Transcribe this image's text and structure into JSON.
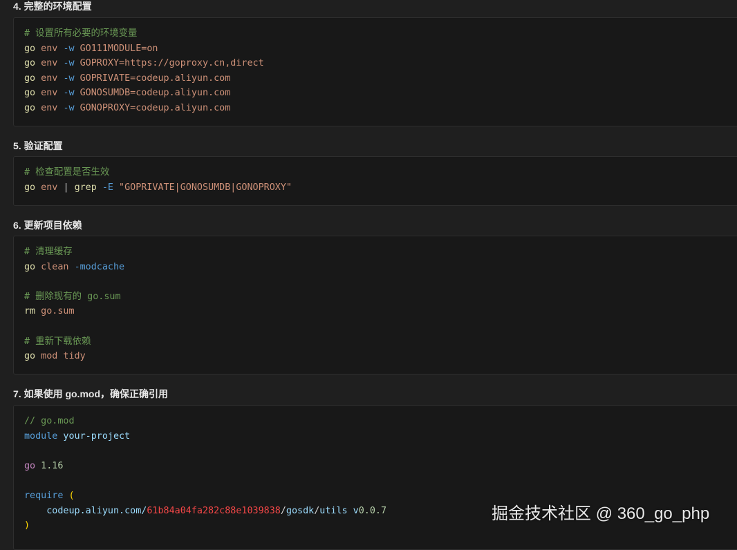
{
  "sections": [
    {
      "heading": "4. 完整的环境配置",
      "lines": [
        [
          {
            "t": "# 设置所有必要的环境变量",
            "k": "comment"
          }
        ],
        [
          {
            "t": "go",
            "k": "cmd"
          },
          {
            "t": " env ",
            "k": "arg"
          },
          {
            "t": "-w",
            "k": "flag"
          },
          {
            "t": " GO111MODULE=on",
            "k": "arg"
          }
        ],
        [
          {
            "t": "go",
            "k": "cmd"
          },
          {
            "t": " env ",
            "k": "arg"
          },
          {
            "t": "-w",
            "k": "flag"
          },
          {
            "t": " GOPROXY=https://goproxy.cn,direct",
            "k": "arg"
          }
        ],
        [
          {
            "t": "go",
            "k": "cmd"
          },
          {
            "t": " env ",
            "k": "arg"
          },
          {
            "t": "-w",
            "k": "flag"
          },
          {
            "t": " GOPRIVATE=codeup.aliyun.com",
            "k": "arg"
          }
        ],
        [
          {
            "t": "go",
            "k": "cmd"
          },
          {
            "t": " env ",
            "k": "arg"
          },
          {
            "t": "-w",
            "k": "flag"
          },
          {
            "t": " GONOSUMDB=codeup.aliyun.com",
            "k": "arg"
          }
        ],
        [
          {
            "t": "go",
            "k": "cmd"
          },
          {
            "t": " env ",
            "k": "arg"
          },
          {
            "t": "-w",
            "k": "flag"
          },
          {
            "t": " GONOPROXY=codeup.aliyun.com",
            "k": "arg"
          }
        ]
      ]
    },
    {
      "heading": "5. 验证配置",
      "lines": [
        [
          {
            "t": "# 检查配置是否生效",
            "k": "comment"
          }
        ],
        [
          {
            "t": "go",
            "k": "cmd"
          },
          {
            "t": " env ",
            "k": "arg"
          },
          {
            "t": "| ",
            "k": "plain"
          },
          {
            "t": "grep",
            "k": "cmd"
          },
          {
            "t": " ",
            "k": "plain"
          },
          {
            "t": "-E",
            "k": "flag"
          },
          {
            "t": " \"GOPRIVATE|GONOSUMDB|GONOPROXY\"",
            "k": "arg"
          }
        ]
      ]
    },
    {
      "heading": "6. 更新项目依赖",
      "lines": [
        [
          {
            "t": "# 清理缓存",
            "k": "comment"
          }
        ],
        [
          {
            "t": "go",
            "k": "cmd"
          },
          {
            "t": " clean ",
            "k": "arg"
          },
          {
            "t": "-modcache",
            "k": "flag"
          }
        ],
        [],
        [
          {
            "t": "# 删除现有的 go.sum",
            "k": "comment"
          }
        ],
        [
          {
            "t": "rm",
            "k": "cmd"
          },
          {
            "t": " go.sum",
            "k": "arg"
          }
        ],
        [],
        [
          {
            "t": "# 重新下载依赖",
            "k": "comment"
          }
        ],
        [
          {
            "t": "go",
            "k": "cmd"
          },
          {
            "t": " mod tidy",
            "k": "arg"
          }
        ]
      ]
    },
    {
      "heading": "7. 如果使用 go.mod，确保正确引用",
      "lines": [
        [
          {
            "t": "// go.mod",
            "k": "comment"
          }
        ],
        [
          {
            "t": "module",
            "k": "kw"
          },
          {
            "t": " your-project",
            "k": "mod"
          }
        ],
        [],
        [
          {
            "t": "go",
            "k": "gokw"
          },
          {
            "t": " 1.16",
            "k": "num"
          }
        ],
        [],
        [
          {
            "t": "require",
            "k": "kw"
          },
          {
            "t": " ",
            "k": "plain"
          },
          {
            "t": "(",
            "k": "brace"
          }
        ],
        [
          {
            "t": "    codeup.aliyun.com/",
            "k": "mod"
          },
          {
            "t": "61b84a04fa282c88e1039838",
            "k": "hash"
          },
          {
            "t": "/",
            "k": "plain"
          },
          {
            "t": "gosdk",
            "k": "mod"
          },
          {
            "t": "/",
            "k": "plain"
          },
          {
            "t": "utils",
            "k": "mod"
          },
          {
            "t": " v",
            "k": "mod"
          },
          {
            "t": "0.0.7",
            "k": "num"
          }
        ],
        [
          {
            "t": ")",
            "k": "brace"
          }
        ]
      ]
    }
  ],
  "watermark": "掘金技术社区 @ 360_go_php",
  "colors": {
    "background": "#1f1f1f",
    "code_background": "#181818",
    "comment": "#6a9955",
    "command": "#dcdcaa",
    "argument": "#ce9178",
    "flag": "#569cd6",
    "keyword": "#569cd6",
    "go_keyword": "#c586c0",
    "number": "#b5cea8",
    "module_path": "#9cdcfe",
    "hash": "#f44747",
    "bracket": "#ffd700"
  }
}
